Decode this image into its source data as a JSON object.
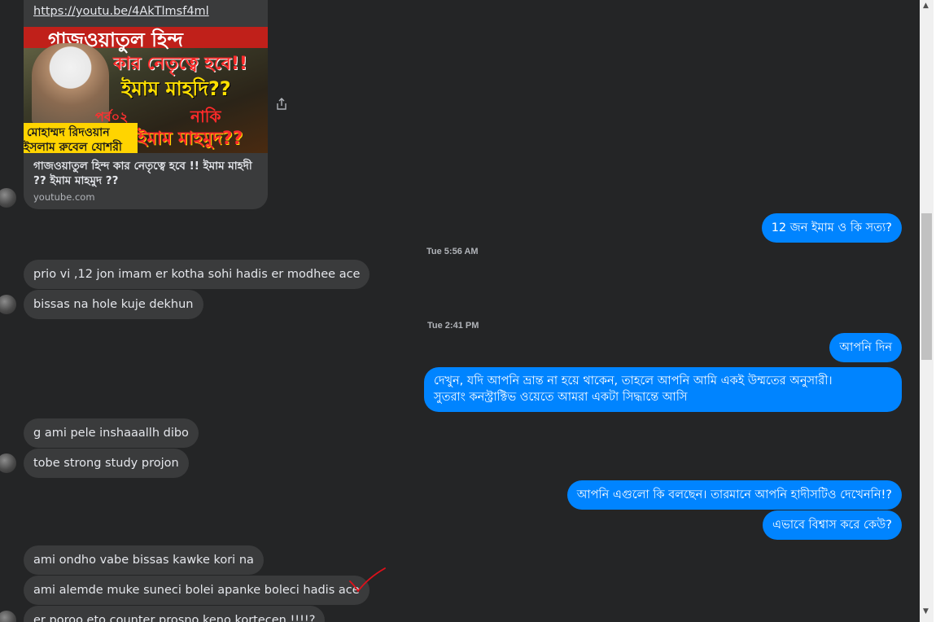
{
  "shared_link": {
    "url": "https://youtu.be/4AkTlmsf4ml",
    "thumbnail_lines": [
      "গাজওয়াতুল হিন্দ",
      "কার নেতৃত্বে হবে!!",
      "ইমাম মাহদি??",
      "নাকি",
      "ইমাম মাহমুদ??",
      "পর্ব০২",
      "মোহাম্মদ রিদওয়ান",
      "ইসলাম রুবেল যোশরী"
    ],
    "title": "গাজওয়াতুল হিন্দ কার নেতৃত্বে হবে !! ইমাম মাহদী ?? ইমাম মাহমুদ ??",
    "domain": "youtube.com"
  },
  "messages": {
    "out_1": "12 জন ইমাম ও কি সত্য?",
    "ts_1": "Tue 5:56 AM",
    "in_1": "prio vi ,12 jon imam er kotha sohi hadis er modhee ace",
    "in_2": "bissas na hole kuje dekhun",
    "ts_2": "Tue 2:41 PM",
    "out_2": "আপনি দিন",
    "out_3_line1": "দেখুন, যদি আপনি ভ্রান্ত না হয়ে থাকেন, তাহলে আপনি আমি একই উম্মতের অনুসারী।",
    "out_3_line2": "সুতরাং কনস্ট্রাক্টিভ ওয়েতে আমরা একটা সিদ্ধান্তে আসি",
    "in_3": "g ami pele inshaaallh dibo",
    "in_4": "tobe strong study projon",
    "out_4": "আপনি এগুলো কি বলছেন। তারমানে আপনি হাদীসটিও দেখেননি!?",
    "out_5": "এভাবে বিশ্বাস করে কেউ?",
    "in_5": "ami ondho vabe bissas kawke kori na",
    "in_6": "ami alemde muke suneci bolei apanke boleci hadis ace",
    "in_7": "er poroo eto counter prosno keno kortecen !!!!?"
  },
  "colors": {
    "background": "#242526",
    "incoming_bubble": "#3a3b3c",
    "outgoing_bubble": "#0084ff",
    "annotation_check": "#e0101a"
  }
}
